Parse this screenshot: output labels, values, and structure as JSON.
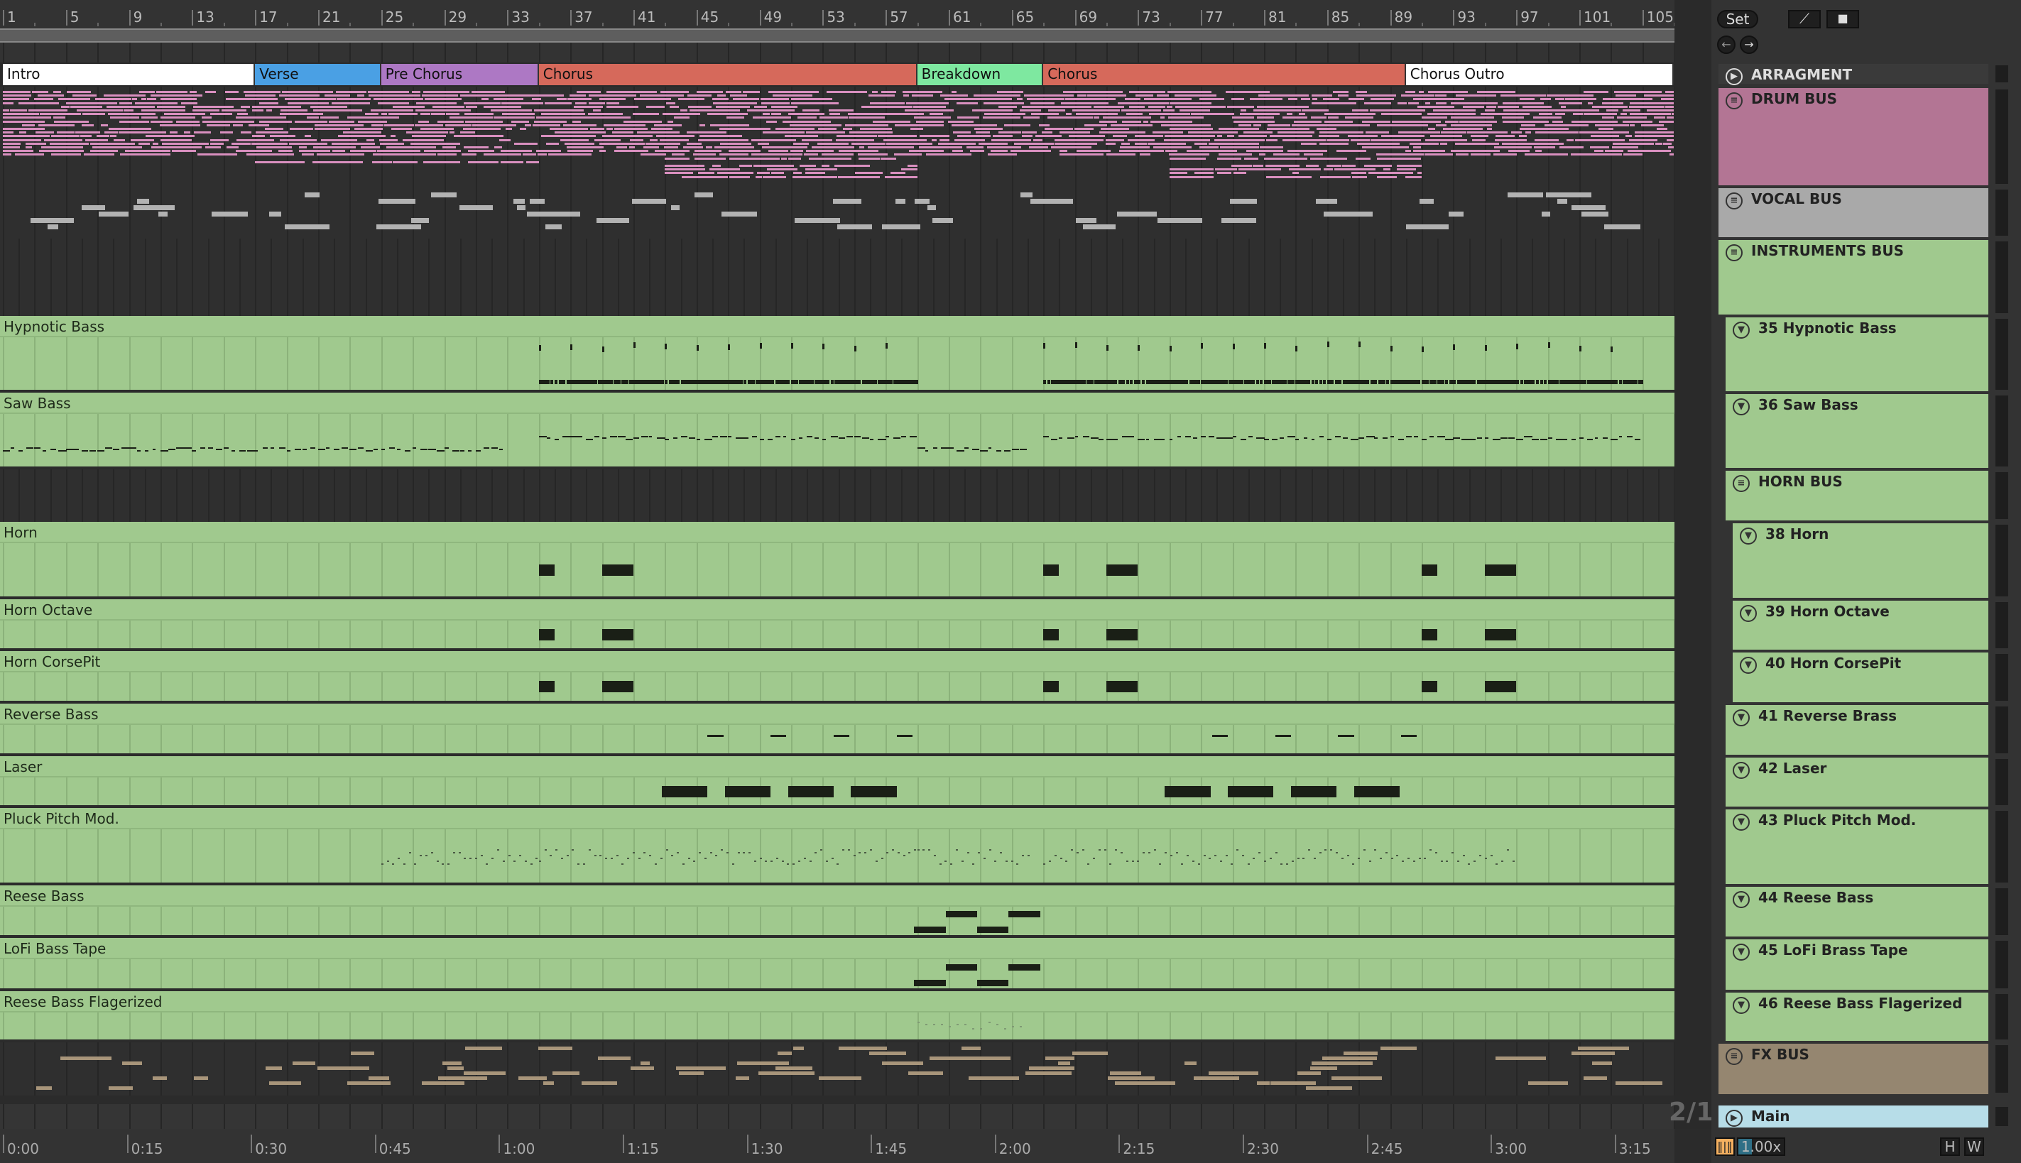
{
  "ruler": {
    "bars": [
      "1",
      "5",
      "9",
      "13",
      "17",
      "21",
      "25",
      "29",
      "33",
      "37",
      "41",
      "45",
      "49",
      "53",
      "57",
      "61",
      "65",
      "69",
      "73",
      "77",
      "81",
      "85",
      "89",
      "93",
      "97",
      "101",
      "105"
    ]
  },
  "locators": [
    {
      "label": "Intro",
      "start": 1,
      "end": 17,
      "color": "#ffffff"
    },
    {
      "label": "Verse",
      "start": 17,
      "end": 25,
      "color": "#4aa0e4"
    },
    {
      "label": "Pre Chorus",
      "start": 25,
      "end": 35,
      "color": "#ad78c4"
    },
    {
      "label": "Chorus",
      "start": 35,
      "end": 59,
      "color": "#d6695b"
    },
    {
      "label": "Breakdown",
      "start": 59,
      "end": 67,
      "color": "#7ee8a0"
    },
    {
      "label": "Chorus",
      "start": 67,
      "end": 90,
      "color": "#d6695b"
    },
    {
      "label": "Chorus Outro",
      "start": 90,
      "end": 107,
      "color": "#ffffff"
    }
  ],
  "clips": [
    {
      "name": "Hypnotic Bass",
      "type": "ticks",
      "regions": [
        [
          35,
          59
        ],
        [
          67,
          105
        ]
      ]
    },
    {
      "name": "Saw Bass",
      "type": "dashes",
      "regions": [
        [
          1,
          33
        ],
        [
          35,
          59
        ],
        [
          59,
          66
        ],
        [
          67,
          105
        ]
      ]
    },
    {
      "name": "Horn",
      "type": "blocks",
      "regions": [
        [
          35,
          36
        ],
        [
          39,
          41
        ],
        [
          67,
          68
        ],
        [
          71,
          73
        ],
        [
          91,
          92
        ],
        [
          95,
          97
        ]
      ]
    },
    {
      "name": "Horn Octave",
      "type": "blocks",
      "regions": [
        [
          35,
          36
        ],
        [
          39,
          41
        ],
        [
          67,
          68
        ],
        [
          71,
          73
        ],
        [
          91,
          92
        ],
        [
          95,
          97
        ]
      ]
    },
    {
      "name": "Horn CorsePit",
      "type": "blocks",
      "regions": [
        [
          35,
          36
        ],
        [
          39,
          41
        ],
        [
          67,
          68
        ],
        [
          71,
          73
        ],
        [
          91,
          92
        ],
        [
          95,
          97
        ]
      ]
    },
    {
      "name": "Reverse Bass",
      "type": "lines",
      "regions": [
        [
          45.7,
          46.7
        ],
        [
          49.7,
          50.7
        ],
        [
          53.7,
          54.7
        ],
        [
          57.7,
          58.7
        ],
        [
          77.7,
          78.7
        ],
        [
          81.7,
          82.7
        ],
        [
          85.7,
          86.7
        ],
        [
          89.7,
          90.7
        ]
      ]
    },
    {
      "name": "Laser",
      "type": "blocks",
      "regions": [
        [
          42.8,
          45.7
        ],
        [
          46.8,
          49.7
        ],
        [
          50.8,
          53.7
        ],
        [
          54.8,
          57.7
        ],
        [
          74.7,
          77.6
        ],
        [
          78.7,
          81.6
        ],
        [
          82.7,
          85.6
        ],
        [
          86.7,
          89.6
        ]
      ]
    },
    {
      "name": "Pluck Pitch Mod.",
      "type": "dots",
      "regions": [
        [
          25,
          35
        ],
        [
          35,
          59
        ],
        [
          59,
          66
        ],
        [
          67,
          97
        ]
      ]
    },
    {
      "name": "Reese Bass",
      "type": "steps",
      "regions": [
        [
          58.8,
          60.8
        ],
        [
          60.8,
          62.8
        ],
        [
          62.8,
          64.8
        ],
        [
          64.8,
          66.8
        ]
      ]
    },
    {
      "name": "LoFi Bass Tape",
      "type": "steps",
      "regions": [
        [
          58.8,
          60.8
        ],
        [
          60.8,
          62.8
        ],
        [
          62.8,
          64.8
        ],
        [
          64.8,
          66.8
        ]
      ]
    },
    {
      "name": "Reese Bass Flagerized",
      "type": "faint",
      "regions": [
        [
          59,
          66
        ]
      ]
    }
  ],
  "panel": {
    "set_label": "Set",
    "tracks": [
      {
        "name": "ARRAGMENT",
        "icon": "play"
      },
      {
        "name": "DRUM BUS",
        "icon": "group",
        "color": "#b37594"
      },
      {
        "name": "VOCAL BUS",
        "icon": "group",
        "color": "#a9a9a9"
      },
      {
        "name": "INSTRUMENTS BUS",
        "icon": "group",
        "color": "#a0c98e"
      },
      {
        "name": "35 Hypnotic Bass",
        "icon": "fold",
        "color": "#a0c98e"
      },
      {
        "name": "36 Saw Bass",
        "icon": "fold",
        "color": "#a0c98e"
      },
      {
        "name": "HORN BUS",
        "icon": "group",
        "color": "#a0c98e"
      },
      {
        "name": "38 Horn",
        "icon": "fold",
        "color": "#a0c98e"
      },
      {
        "name": "39 Horn Octave",
        "icon": "fold",
        "color": "#a0c98e"
      },
      {
        "name": "40 Horn CorsePit",
        "icon": "fold",
        "color": "#a0c98e"
      },
      {
        "name": "41 Reverse Brass",
        "icon": "fold",
        "color": "#a0c98e"
      },
      {
        "name": "42 Laser",
        "icon": "fold",
        "color": "#a0c98e"
      },
      {
        "name": "43 Pluck Pitch Mod.",
        "icon": "fold",
        "color": "#a0c98e"
      },
      {
        "name": "44 Reese Bass",
        "icon": "fold",
        "color": "#a0c98e"
      },
      {
        "name": "45 LoFi Brass Tape",
        "icon": "fold",
        "color": "#a0c98e"
      },
      {
        "name": "46 Reese Bass Flagerized",
        "icon": "fold",
        "color": "#a0c98e"
      },
      {
        "name": "FX BUS",
        "icon": "group",
        "color": "#958670"
      },
      {
        "name": "Main",
        "icon": "play",
        "color": "#b7dde8"
      }
    ],
    "grid_label": "2/1",
    "zoom_value": "1.00x",
    "h_label": "H",
    "w_label": "W"
  },
  "time_ruler": [
    "0:00",
    "0:15",
    "0:30",
    "0:45",
    "1:00",
    "1:15",
    "1:30",
    "1:45",
    "2:00",
    "2:15",
    "2:30",
    "2:45",
    "3:00",
    "3:15"
  ]
}
